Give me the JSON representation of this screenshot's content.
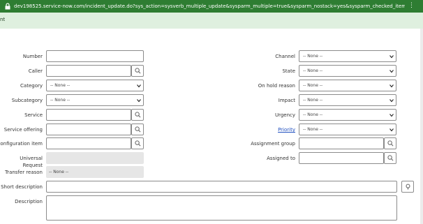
{
  "browser": {
    "url": "dev198525.service-now.com/incident_update.do?sys_action=sysverb_multiple_update&sysparm_multiple=true&sysparm_nostack=yes&sysparm_checked_items=sys...",
    "lock_icon": "lock-icon"
  },
  "header": {
    "title_fragment": "nt"
  },
  "form": {
    "left": {
      "number": {
        "label": "Number",
        "value": ""
      },
      "caller": {
        "label": "Caller",
        "value": ""
      },
      "category": {
        "label": "Category",
        "value": "-- None --"
      },
      "subcategory": {
        "label": "Subcategory",
        "value": "-- None --"
      },
      "service": {
        "label": "Service",
        "value": ""
      },
      "service_offering": {
        "label": "Service offering",
        "value": ""
      },
      "configuration_item": {
        "label": "Configuration item",
        "value": ""
      },
      "universal_request": {
        "label": "Universal Request",
        "value": ""
      },
      "transfer_reason": {
        "label": "Transfer reason",
        "value": "-- None --"
      }
    },
    "right": {
      "channel": {
        "label": "Channel",
        "value": "-- None --"
      },
      "state": {
        "label": "State",
        "value": "-- None --"
      },
      "on_hold_reason": {
        "label": "On hold reason",
        "value": "-- None --"
      },
      "impact": {
        "label": "Impact",
        "value": "-- None --"
      },
      "urgency": {
        "label": "Urgency",
        "value": "-- None --"
      },
      "priority": {
        "label": "Priority",
        "value": "-- None --"
      },
      "assignment_group": {
        "label": "Assignment group",
        "value": ""
      },
      "assigned_to": {
        "label": "Assigned to",
        "value": ""
      }
    },
    "short_description": {
      "label": "Short description",
      "value": ""
    },
    "description": {
      "label": "Description",
      "value": ""
    }
  }
}
